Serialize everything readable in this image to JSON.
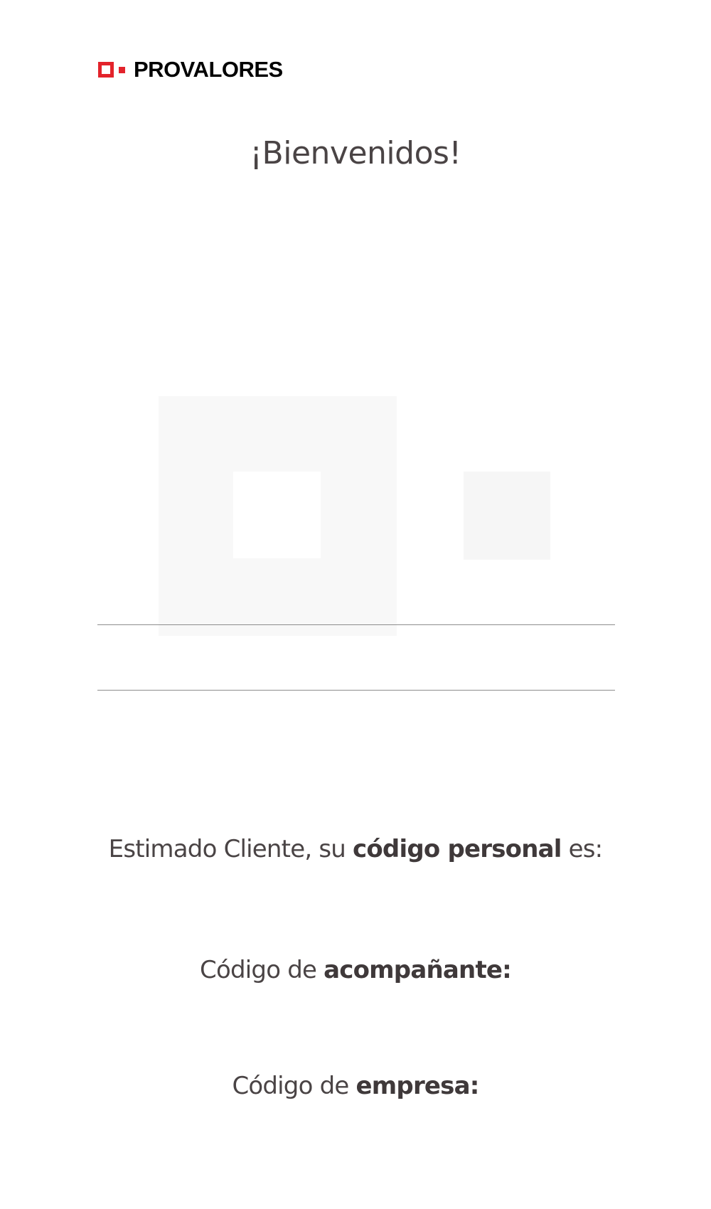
{
  "brand": {
    "name": "PROVALORES",
    "accent_color": "#e3232b",
    "logo_icon": "provalores-logo-icon"
  },
  "header": {
    "title": "¡Bienvenidos!"
  },
  "codes": {
    "personal": {
      "prefix": "Estimado Cliente, su ",
      "emphasis": "código personal",
      "suffix": " es:"
    },
    "companion": {
      "prefix": "Código de ",
      "emphasis": "acompañante:"
    },
    "company": {
      "prefix": "Código de ",
      "emphasis": "empresa:"
    }
  },
  "colors": {
    "text": "#4a4445",
    "divider": "#8d8d8d",
    "placeholder": "#f8f8f8"
  }
}
